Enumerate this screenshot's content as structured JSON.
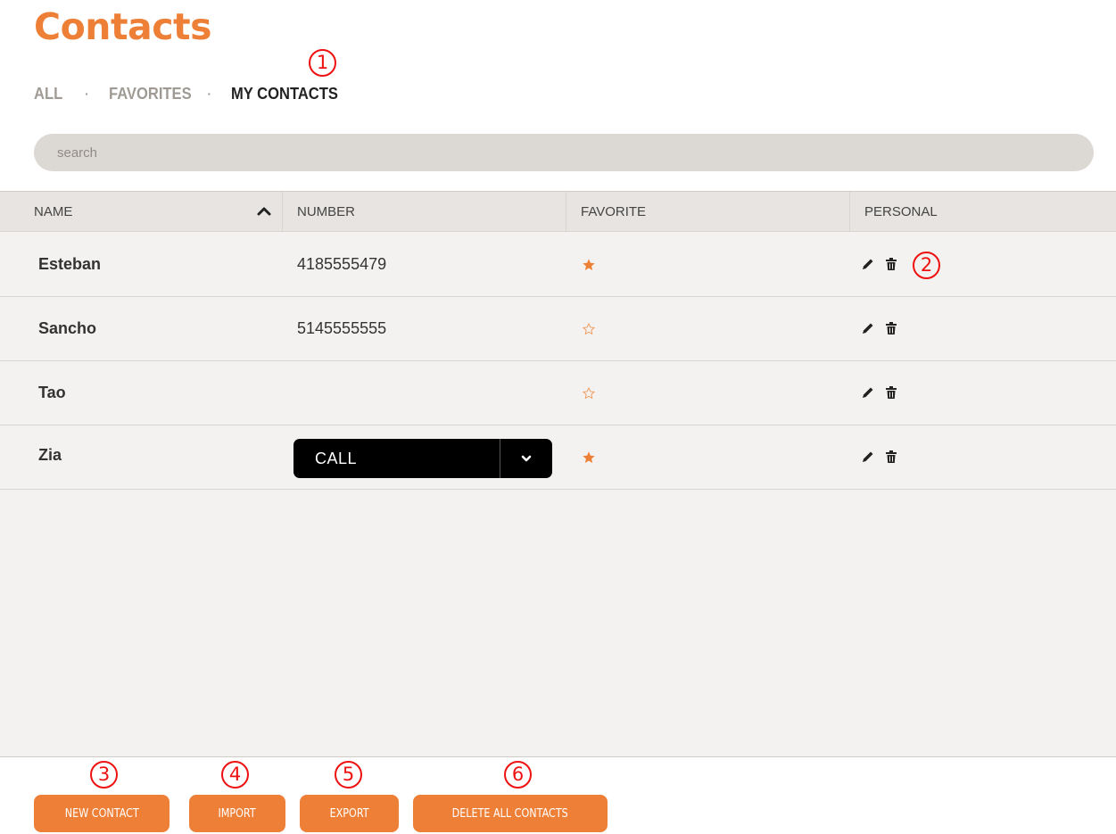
{
  "page": {
    "title": "Contacts"
  },
  "tabs": [
    {
      "label": "ALL",
      "active": false
    },
    {
      "label": "FAVORITES",
      "active": false
    },
    {
      "label": "MY CONTACTS",
      "active": true
    }
  ],
  "tab_separator": "·",
  "search": {
    "placeholder": "search",
    "value": ""
  },
  "table": {
    "headers": {
      "name": "NAME",
      "number": "NUMBER",
      "favorite": "FAVORITE",
      "personal": "PERSONAL"
    },
    "sort": {
      "column": "name",
      "direction": "ascending",
      "icon": "chevron-up-icon"
    },
    "rows": [
      {
        "name": "Esteban",
        "number": "4185555479",
        "favorite": true
      },
      {
        "name": "Sancho",
        "number": "5145555555",
        "favorite": false
      },
      {
        "name": "Tao",
        "number": "",
        "favorite": false
      },
      {
        "name": "Zia",
        "number": "",
        "favorite": true
      }
    ]
  },
  "call_button": {
    "label": "CALL",
    "dropdown_icon": "chevron-down-icon"
  },
  "actions": {
    "edit_icon": "pencil-icon",
    "delete_icon": "trash-icon"
  },
  "footer": {
    "new_contact": "NEW CONTACT",
    "import": "IMPORT",
    "export": "EXPORT",
    "delete_all": "DELETE ALL CONTACTS"
  },
  "annotations": [
    "1",
    "2",
    "3",
    "4",
    "5",
    "6"
  ],
  "colors": {
    "accent": "#ee7f36",
    "annotation": "#ee1111",
    "table_background": "#f4f2f0",
    "header_background": "#e7e4e1",
    "search_background": "#dcd8d4",
    "call_button": "#000000"
  }
}
